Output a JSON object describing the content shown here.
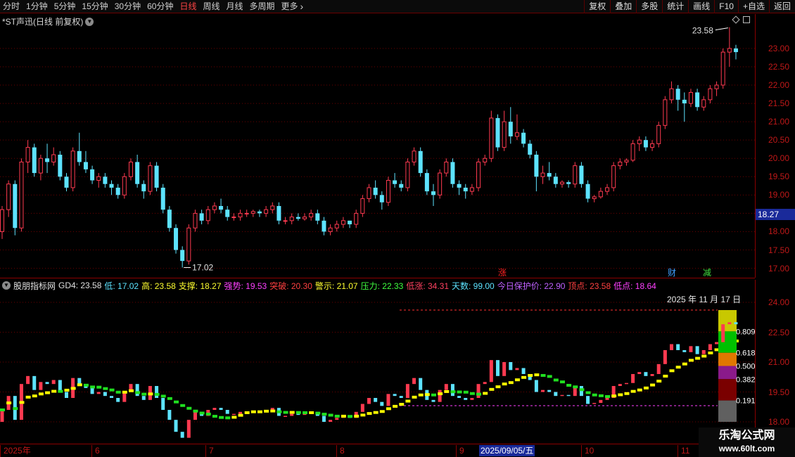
{
  "toolbar": {
    "periods": [
      "分时",
      "1分钟",
      "5分钟",
      "15分钟",
      "30分钟",
      "60分钟",
      "日线",
      "周线",
      "月线",
      "多周期",
      "更多"
    ],
    "active_period": "日线",
    "right_buttons": [
      "复权",
      "叠加",
      "多股",
      "统计",
      "画线",
      "F10",
      "+自选",
      "返回"
    ]
  },
  "stock": {
    "title": "*ST声迅(日线 前复权)"
  },
  "price_axis": {
    "labels": [
      "23.00",
      "22.50",
      "22.00",
      "21.50",
      "21.00",
      "20.50",
      "20.00",
      "19.50",
      "19.00",
      "18.50",
      "18.00",
      "17.50",
      "17.00"
    ],
    "current": "18.27"
  },
  "annotations": {
    "high": "23.58",
    "low": "17.02"
  },
  "event_tags": [
    {
      "text": "涨",
      "color": "#ff2020"
    },
    {
      "text": "财",
      "color": "#40a0ff"
    },
    {
      "text": "减",
      "color": "#40e040"
    }
  ],
  "indicator": {
    "name": "股朋指标网",
    "items": [
      {
        "text": "GD4: 23.58",
        "color": "#e0e0e0"
      },
      {
        "text": "低: 17.02",
        "color": "#5de3ff"
      },
      {
        "text": "高: 23.58",
        "color": "#ffff30"
      },
      {
        "text": "支撑: 18.27",
        "color": "#ffff30"
      },
      {
        "text": "强势: 19.53",
        "color": "#ff40ff"
      },
      {
        "text": "突破: 20.30",
        "color": "#ff4040"
      },
      {
        "text": "警示: 21.07",
        "color": "#ffff30"
      },
      {
        "text": "压力: 22.33",
        "color": "#40ff40"
      },
      {
        "text": "低涨: 34.31",
        "color": "#ff4060"
      },
      {
        "text": "天数: 99.00",
        "color": "#5de3ff"
      },
      {
        "text": "今日保护价: 22.90",
        "color": "#c060ff"
      },
      {
        "text": "顶点: 23.58",
        "color": "#ff4040"
      },
      {
        "text": "低点: 18.64",
        "color": "#ff40ff"
      }
    ],
    "date": "2025 年 11 月 17 日",
    "axis_labels": [
      "24.00",
      "22.50",
      "21.00",
      "19.50",
      "18.00"
    ],
    "fib_labels": [
      "0.809",
      "0.618",
      "0.500",
      "0.382",
      "0.191"
    ]
  },
  "date_axis": {
    "labels": [
      "2025年",
      "6",
      "7",
      "8",
      "9",
      "10",
      "11"
    ],
    "cursor": "2025/09/05/五"
  },
  "watermark": {
    "title": "乐淘公式网",
    "url": "www.60lt.com"
  },
  "colors": {
    "up": "#ff3a50",
    "down": "#5de3ff",
    "grid": "#6b0000",
    "axis": "#c01818"
  },
  "chart_data": {
    "type": "candlestick",
    "ylim": [
      16.8,
      23.9
    ],
    "ohlc": [
      [
        18.0,
        18.7,
        17.8,
        18.6
      ],
      [
        18.6,
        19.4,
        18.4,
        19.3
      ],
      [
        19.3,
        19.4,
        17.9,
        18.1
      ],
      [
        18.1,
        20.0,
        18.0,
        19.9
      ],
      [
        19.9,
        20.5,
        19.6,
        20.3
      ],
      [
        20.3,
        20.4,
        19.5,
        19.6
      ],
      [
        19.6,
        20.1,
        19.4,
        20.0
      ],
      [
        20.0,
        20.4,
        19.6,
        19.9
      ],
      [
        19.9,
        20.3,
        19.8,
        20.1
      ],
      [
        20.1,
        20.2,
        19.4,
        19.5
      ],
      [
        19.5,
        19.6,
        19.1,
        19.2
      ],
      [
        19.2,
        20.3,
        19.1,
        20.2
      ],
      [
        20.2,
        20.7,
        19.8,
        19.9
      ],
      [
        19.9,
        20.2,
        19.6,
        19.7
      ],
      [
        19.7,
        19.8,
        19.3,
        19.4
      ],
      [
        19.4,
        19.6,
        19.2,
        19.5
      ],
      [
        19.5,
        19.6,
        19.2,
        19.3
      ],
      [
        19.3,
        19.4,
        19.0,
        19.2
      ],
      [
        19.2,
        19.3,
        18.9,
        19.0
      ],
      [
        19.0,
        19.6,
        18.9,
        19.5
      ],
      [
        19.5,
        20.0,
        19.4,
        19.9
      ],
      [
        19.9,
        20.1,
        19.2,
        19.3
      ],
      [
        19.3,
        19.4,
        18.9,
        19.1
      ],
      [
        19.1,
        19.9,
        19.0,
        19.8
      ],
      [
        19.8,
        19.9,
        19.1,
        19.2
      ],
      [
        19.2,
        19.3,
        18.5,
        18.6
      ],
      [
        18.6,
        18.7,
        18.0,
        18.1
      ],
      [
        18.1,
        18.2,
        17.4,
        17.5
      ],
      [
        17.5,
        17.6,
        17.02,
        17.2
      ],
      [
        17.2,
        18.2,
        17.1,
        18.1
      ],
      [
        18.1,
        18.6,
        18.0,
        18.5
      ],
      [
        18.5,
        18.6,
        18.2,
        18.3
      ],
      [
        18.3,
        18.7,
        18.2,
        18.6
      ],
      [
        18.6,
        18.8,
        18.5,
        18.7
      ],
      [
        18.7,
        18.9,
        18.5,
        18.6
      ],
      [
        18.6,
        18.7,
        18.3,
        18.4
      ],
      [
        18.4,
        18.5,
        18.3,
        18.4
      ],
      [
        18.4,
        18.6,
        18.3,
        18.5
      ],
      [
        18.5,
        18.6,
        18.4,
        18.5
      ],
      [
        18.5,
        18.6,
        18.4,
        18.55
      ],
      [
        18.55,
        18.6,
        18.4,
        18.5
      ],
      [
        18.5,
        18.7,
        18.4,
        18.6
      ],
      [
        18.6,
        18.8,
        18.5,
        18.7
      ],
      [
        18.7,
        18.8,
        18.2,
        18.3
      ],
      [
        18.3,
        18.4,
        18.2,
        18.3
      ],
      [
        18.3,
        18.5,
        18.2,
        18.4
      ],
      [
        18.4,
        18.5,
        18.3,
        18.35
      ],
      [
        18.35,
        18.5,
        18.3,
        18.4
      ],
      [
        18.4,
        18.6,
        18.3,
        18.5
      ],
      [
        18.5,
        18.6,
        18.2,
        18.3
      ],
      [
        18.3,
        18.4,
        17.9,
        18.0
      ],
      [
        18.0,
        18.2,
        17.9,
        18.1
      ],
      [
        18.1,
        18.3,
        18.0,
        18.2
      ],
      [
        18.2,
        18.4,
        18.1,
        18.3
      ],
      [
        18.3,
        18.3,
        18.1,
        18.2
      ],
      [
        18.2,
        18.6,
        18.1,
        18.5
      ],
      [
        18.5,
        19.0,
        18.4,
        18.9
      ],
      [
        18.9,
        19.3,
        18.8,
        19.2
      ],
      [
        19.2,
        19.4,
        18.9,
        19.0
      ],
      [
        19.0,
        19.1,
        18.6,
        18.8
      ],
      [
        18.8,
        19.5,
        18.7,
        19.4
      ],
      [
        19.4,
        19.6,
        19.2,
        19.3
      ],
      [
        19.3,
        19.4,
        19.1,
        19.2
      ],
      [
        19.2,
        20.0,
        19.1,
        19.9
      ],
      [
        19.9,
        20.3,
        19.8,
        20.2
      ],
      [
        20.2,
        20.3,
        19.5,
        19.6
      ],
      [
        19.6,
        19.7,
        19.0,
        19.1
      ],
      [
        19.1,
        19.3,
        18.7,
        19.0
      ],
      [
        19.0,
        19.7,
        18.9,
        19.6
      ],
      [
        19.6,
        20.0,
        19.5,
        19.9
      ],
      [
        19.9,
        20.0,
        19.2,
        19.3
      ],
      [
        19.3,
        19.4,
        19.0,
        19.2
      ],
      [
        19.2,
        19.3,
        18.9,
        19.1
      ],
      [
        19.1,
        19.3,
        19.0,
        19.2
      ],
      [
        19.2,
        20.0,
        19.1,
        19.9
      ],
      [
        19.9,
        20.1,
        19.8,
        20.0
      ],
      [
        20.0,
        21.3,
        19.9,
        21.1
      ],
      [
        21.1,
        21.2,
        20.2,
        20.3
      ],
      [
        20.3,
        21.3,
        20.2,
        21.0
      ],
      [
        21.0,
        21.4,
        20.4,
        20.6
      ],
      [
        20.6,
        21.2,
        20.5,
        20.7
      ],
      [
        20.7,
        20.8,
        20.3,
        20.4
      ],
      [
        20.4,
        20.5,
        20.0,
        20.1
      ],
      [
        20.1,
        20.2,
        19.1,
        19.5
      ],
      [
        19.5,
        19.8,
        19.3,
        19.6
      ],
      [
        19.6,
        19.9,
        19.4,
        19.5
      ],
      [
        19.5,
        19.6,
        19.2,
        19.3
      ],
      [
        19.3,
        19.4,
        19.2,
        19.35
      ],
      [
        19.35,
        19.4,
        19.2,
        19.3
      ],
      [
        19.3,
        19.9,
        19.2,
        19.8
      ],
      [
        19.8,
        19.9,
        19.2,
        19.3
      ],
      [
        19.3,
        19.4,
        18.8,
        18.9
      ],
      [
        18.9,
        19.0,
        18.8,
        18.95
      ],
      [
        18.95,
        19.2,
        18.9,
        19.1
      ],
      [
        19.1,
        19.3,
        19.0,
        19.2
      ],
      [
        19.2,
        19.9,
        19.1,
        19.8
      ],
      [
        19.8,
        20.0,
        19.7,
        19.9
      ],
      [
        19.9,
        20.0,
        19.8,
        19.95
      ],
      [
        19.95,
        20.5,
        19.9,
        20.4
      ],
      [
        20.4,
        20.6,
        20.2,
        20.5
      ],
      [
        20.5,
        20.6,
        20.2,
        20.3
      ],
      [
        20.3,
        20.5,
        20.2,
        20.4
      ],
      [
        20.4,
        21.0,
        20.3,
        20.9
      ],
      [
        20.9,
        21.7,
        20.8,
        21.6
      ],
      [
        21.6,
        22.1,
        21.5,
        21.9
      ],
      [
        21.9,
        22.0,
        21.3,
        21.6
      ],
      [
        21.6,
        21.8,
        21.0,
        21.5
      ],
      [
        21.5,
        21.9,
        21.4,
        21.8
      ],
      [
        21.8,
        21.9,
        21.3,
        21.4
      ],
      [
        21.4,
        21.7,
        21.3,
        21.6
      ],
      [
        21.6,
        22.0,
        21.5,
        21.9
      ],
      [
        21.9,
        22.1,
        21.7,
        22.0
      ],
      [
        22.0,
        23.0,
        21.9,
        22.9
      ],
      [
        22.9,
        23.58,
        22.5,
        23.0
      ],
      [
        23.0,
        23.1,
        22.7,
        22.9
      ]
    ],
    "fib_levels": [
      0.191,
      0.382,
      0.5,
      0.618,
      0.809
    ]
  }
}
